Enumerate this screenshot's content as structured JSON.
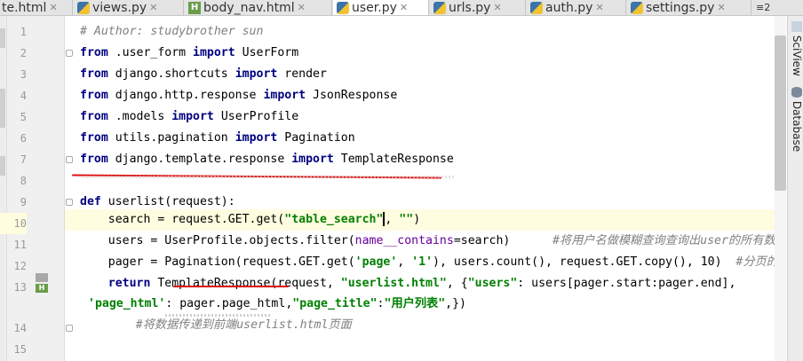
{
  "tabs": [
    {
      "label": "te.html",
      "type": "html",
      "active": false
    },
    {
      "label": "views.py",
      "type": "py",
      "active": false
    },
    {
      "label": "body_nav.html",
      "type": "html",
      "active": false
    },
    {
      "label": "user.py",
      "type": "py",
      "active": true
    },
    {
      "label": "urls.py",
      "type": "py",
      "active": false
    },
    {
      "label": "auth.py",
      "type": "py",
      "active": false
    },
    {
      "label": "settings.py",
      "type": "py",
      "active": false
    }
  ],
  "tab_overflow": "≡2",
  "right_tools": [
    {
      "label": "SciView",
      "icon": "sciview-icon"
    },
    {
      "label": "Database",
      "icon": "database-icon"
    }
  ],
  "line_numbers": [
    "1",
    "2",
    "3",
    "4",
    "5",
    "6",
    "7",
    "8",
    "9",
    "10",
    "11",
    "12",
    "13",
    "14",
    "15"
  ],
  "code": {
    "l1": "# Author: studybrother sun",
    "l2": {
      "kw": "from",
      "a": " .user_form ",
      "kw2": "import",
      "b": " UserForm"
    },
    "l3": {
      "kw": "from",
      "a": " django.shortcuts ",
      "kw2": "import",
      "b": " render"
    },
    "l4": {
      "kw": "from",
      "a": " django.http.response ",
      "kw2": "import",
      "b": " JsonResponse"
    },
    "l5": {
      "kw": "from",
      "a": " .models ",
      "kw2": "import",
      "b": " UserProfile"
    },
    "l6": {
      "kw": "from",
      "a": " utils.pagination ",
      "kw2": "import",
      "b": " Pagination"
    },
    "l7": {
      "kw": "from",
      "a": " django.template.response ",
      "kw2": "import",
      "b": " TemplateResponse"
    },
    "l9": {
      "kw": "def",
      "a": " userlist(request):"
    },
    "l10": {
      "a": "    search = request.GET.get(",
      "s1": "\"table_search\"",
      "b": ", ",
      "s2": "\"\"",
      "c": ")"
    },
    "l11": {
      "a": "    users = UserProfile.objects.filter(",
      "p": "name__contains",
      "b": "=search)      ",
      "cm": "#将用户名做模糊查询查询出user的所有数"
    },
    "l12": {
      "a": "    pager = Pagination(request.GET.get(",
      "s1": "'page'",
      "b": ", ",
      "s2": "'1'",
      "c": "), users.count(), request.GET.copy(), 10)  ",
      "cm": "#分页的"
    },
    "l13": {
      "kw": "    return",
      "a": " TemplateResponse(request, ",
      "s1": "\"userlist.html\"",
      "b": ", {",
      "s2": "\"users\"",
      "c": ": users[pager.start:pager.end],"
    },
    "l13b": {
      "s1": "'page_html'",
      "a": ": pager.page_html,",
      "s2": "\"page_title\"",
      "b": ":",
      "s3": "\"用户列表\"",
      "c": ",})"
    },
    "l14": "    #将数据传递到前端userlist.html页面"
  }
}
